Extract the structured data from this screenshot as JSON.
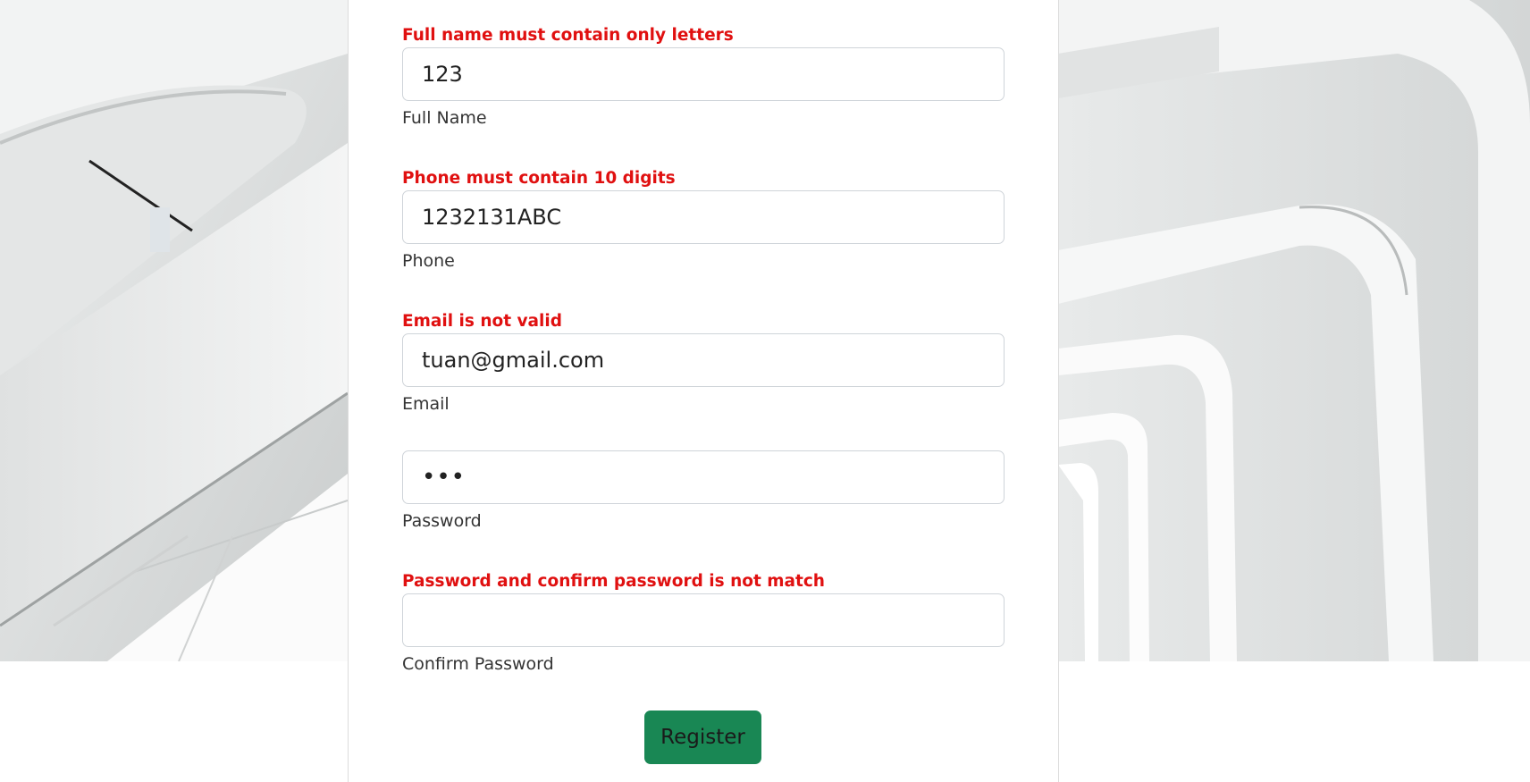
{
  "form": {
    "full_name": {
      "error": "Full name must contain only letters",
      "value": "123",
      "label": "Full Name"
    },
    "phone": {
      "error": "Phone must contain 10 digits",
      "value": "1232131ABC",
      "label": "Phone"
    },
    "email": {
      "error": "Email is not valid",
      "value": "tuan@gmail.com",
      "label": "Email"
    },
    "password": {
      "value": "•••",
      "label": "Password"
    },
    "confirm_password": {
      "error": "Password and confirm password is not match",
      "value": "",
      "label": "Confirm Password"
    },
    "register_label": "Register"
  },
  "colors": {
    "error": "#e01010",
    "button": "#198754",
    "input_border": "#cfd4d9"
  }
}
